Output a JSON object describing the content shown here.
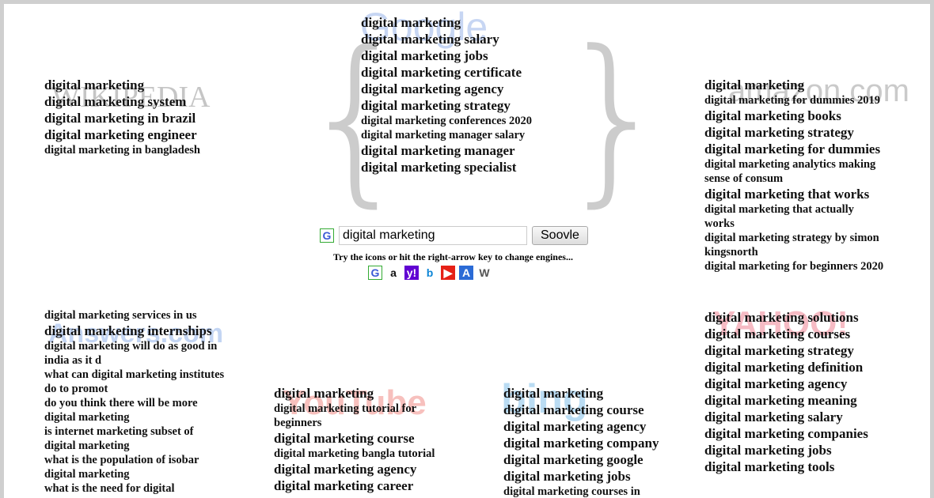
{
  "search": {
    "value": "digital marketing",
    "button": "Soovle",
    "hint": "Try the icons or hit the right-arrow key to change engines...",
    "current_engine": "google"
  },
  "engines": [
    {
      "name": "google",
      "glyph": "G",
      "color": "#3b5bd6",
      "bg": "#fff"
    },
    {
      "name": "amazon",
      "glyph": "a",
      "color": "#111",
      "bg": "#fff"
    },
    {
      "name": "yahoo",
      "glyph": "y!",
      "color": "#fff",
      "bg": "#6001d2"
    },
    {
      "name": "bing",
      "glyph": "b",
      "color": "#0a84d6",
      "bg": "#fff"
    },
    {
      "name": "youtube",
      "glyph": "▶",
      "color": "#fff",
      "bg": "#e62117"
    },
    {
      "name": "answers",
      "glyph": "A",
      "color": "#fff",
      "bg": "#2b6bd6"
    },
    {
      "name": "wikipedia",
      "glyph": "W",
      "color": "#555",
      "bg": "#fff"
    }
  ],
  "logos": {
    "google": "Google",
    "wikipedia": "WIKIPEDIA",
    "amazon": "amazon.com",
    "yahoo": "YAHOO!",
    "answers": "Answers.com",
    "youtube": "YouTube",
    "bing": "bing"
  },
  "columns": {
    "wikipedia": [
      [
        "digital marketing",
        "big"
      ],
      [
        "digital marketing system",
        "big"
      ],
      [
        "digital marketing in brazil",
        "big"
      ],
      [
        "digital marketing engineer",
        "big"
      ],
      [
        "digital marketing in bangladesh",
        "small"
      ]
    ],
    "google": [
      [
        "digital marketing",
        "big"
      ],
      [
        "digital marketing salary",
        "big"
      ],
      [
        "digital marketing jobs",
        "big"
      ],
      [
        "digital marketing certificate",
        "big"
      ],
      [
        "digital marketing agency",
        "big"
      ],
      [
        "digital marketing strategy",
        "big"
      ],
      [
        "digital marketing conferences 2020",
        "small"
      ],
      [
        "digital marketing manager salary",
        "small"
      ],
      [
        "digital marketing manager",
        "big"
      ],
      [
        "digital marketing specialist",
        "big"
      ]
    ],
    "amazon": [
      [
        "digital marketing",
        "big"
      ],
      [
        "digital marketing for dummies 2019",
        "small"
      ],
      [
        "digital marketing books",
        "big"
      ],
      [
        "digital marketing strategy",
        "big"
      ],
      [
        "digital marketing for dummies",
        "big"
      ],
      [
        "digital marketing analytics making sense of consum",
        "small"
      ],
      [
        "digital marketing that works",
        "big"
      ],
      [
        "digital marketing that actually works",
        "small"
      ],
      [
        "digital marketing strategy by simon kingsnorth",
        "small"
      ],
      [
        "digital marketing for beginners 2020",
        "small"
      ]
    ],
    "yahoo": [
      [
        "digital marketing solutions",
        "big"
      ],
      [
        "digital marketing courses",
        "big"
      ],
      [
        "digital marketing strategy",
        "big"
      ],
      [
        "digital marketing definition",
        "big"
      ],
      [
        "digital marketing agency",
        "big"
      ],
      [
        "digital marketing meaning",
        "big"
      ],
      [
        "digital marketing salary",
        "big"
      ],
      [
        "digital marketing companies",
        "big"
      ],
      [
        "digital marketing jobs",
        "big"
      ],
      [
        "digital marketing tools",
        "big"
      ]
    ],
    "answers": [
      [
        "digital marketing services in us",
        "small"
      ],
      [
        "digital marketing internships",
        "big"
      ],
      [
        "digital marketing will do as good in india as it d",
        "small"
      ],
      [
        "what can digital marketing institutes do to promot",
        "small"
      ],
      [
        "do you think there will be more digital marketing",
        "small"
      ],
      [
        "is internet marketing subset of digital marketing",
        "small"
      ],
      [
        "what is the population of isobar digital marketing",
        "small"
      ],
      [
        "what is the need for digital",
        "small"
      ]
    ],
    "youtube": [
      [
        "digital marketing",
        "big"
      ],
      [
        "digital marketing tutorial for beginners",
        "small"
      ],
      [
        "digital marketing course",
        "big"
      ],
      [
        "digital marketing bangla tutorial",
        "small"
      ],
      [
        "digital marketing agency",
        "big"
      ],
      [
        "digital marketing career",
        "big"
      ]
    ],
    "bing": [
      [
        "digital marketing",
        "big"
      ],
      [
        "digital marketing course",
        "big"
      ],
      [
        "digital marketing agency",
        "big"
      ],
      [
        "digital marketing company",
        "big"
      ],
      [
        "digital marketing google",
        "big"
      ],
      [
        "digital marketing jobs",
        "big"
      ],
      [
        "digital marketing courses in",
        "small"
      ]
    ]
  }
}
